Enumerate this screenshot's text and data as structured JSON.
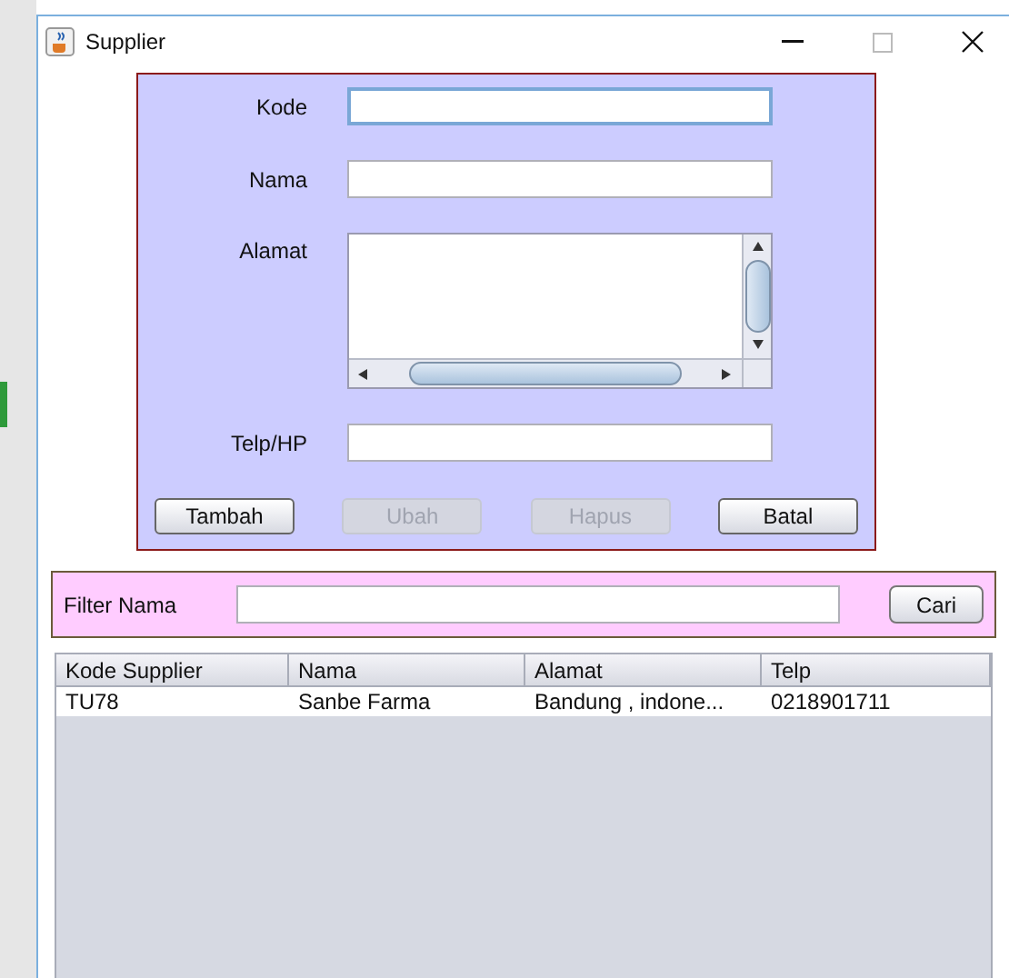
{
  "window": {
    "title": "Supplier"
  },
  "form": {
    "fields": [
      {
        "label": "Kode",
        "kind": "text",
        "focused": true
      },
      {
        "label": "Nama",
        "kind": "text",
        "focused": false
      },
      {
        "label": "Alamat",
        "kind": "textarea",
        "focused": false
      },
      {
        "label": "Telp/HP",
        "kind": "text",
        "focused": false
      }
    ],
    "buttons": [
      {
        "label": "Tambah",
        "disabled": false
      },
      {
        "label": "Ubah",
        "disabled": true
      },
      {
        "label": "Hapus",
        "disabled": true
      },
      {
        "label": "Batal",
        "disabled": false
      }
    ]
  },
  "filter": {
    "label": "Filter Nama",
    "button": "Cari"
  },
  "table": {
    "columns": [
      "Kode Supplier",
      "Nama",
      "Alamat",
      "Telp"
    ],
    "rows": [
      [
        "TU78",
        "Sanbe Farma",
        "Bandung , indone...",
        "0218901711"
      ]
    ]
  }
}
